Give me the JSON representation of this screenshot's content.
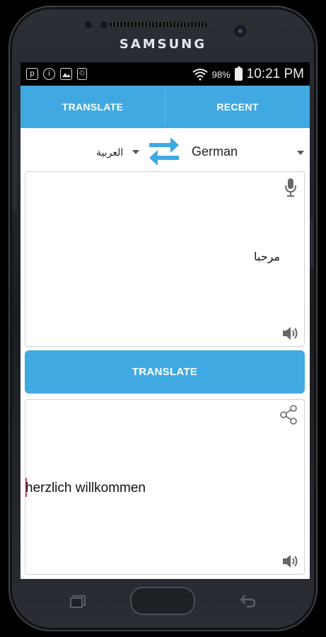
{
  "device": {
    "brand": "SAMSUNG"
  },
  "status_bar": {
    "left_icons": [
      "pinterest-icon",
      "info-icon",
      "image-icon",
      "recycle-icon"
    ],
    "wifi": "wifi-icon",
    "battery_percent": "98%",
    "time": "10:21 PM"
  },
  "tabs": [
    {
      "label": "TRANSLATE",
      "active": true
    },
    {
      "label": "RECENT",
      "active": false
    }
  ],
  "languages": {
    "source": "العربية",
    "target": "German"
  },
  "input": {
    "text": "مرحبا"
  },
  "translate_button": {
    "label": "TRANSLATE"
  },
  "output": {
    "text": "herzlich willkommen"
  },
  "colors": {
    "accent": "#41a9e1",
    "accent_dark": "#2f8fcf"
  }
}
